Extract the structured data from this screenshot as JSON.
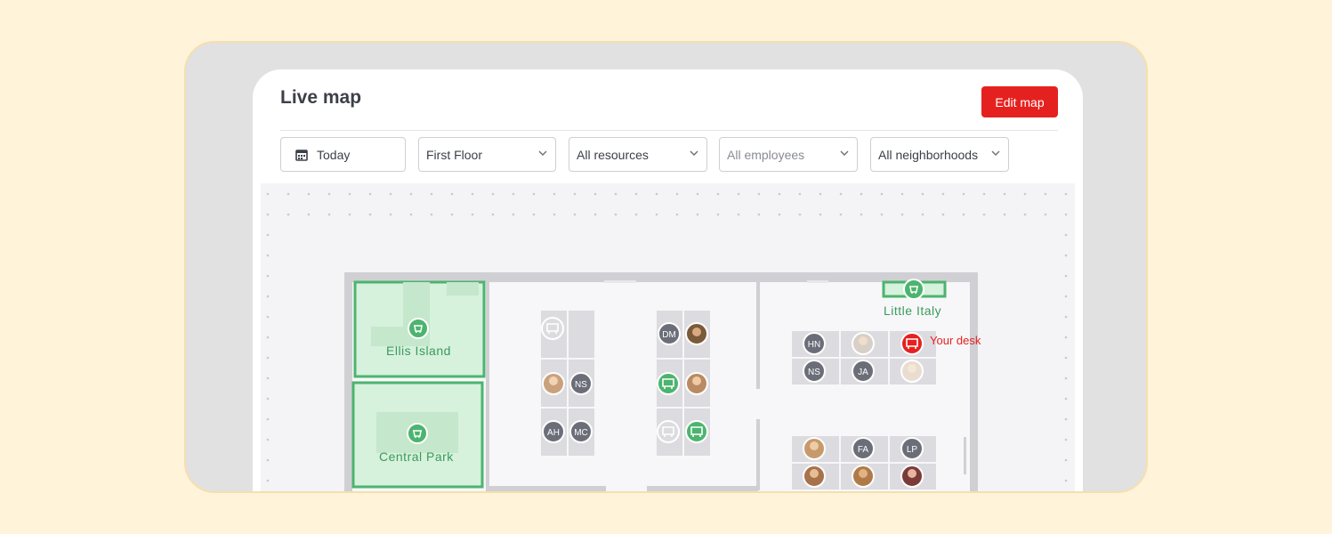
{
  "header": {
    "title": "Live map",
    "edit_label": "Edit map"
  },
  "filters": {
    "date": "Today",
    "floor": "First Floor",
    "resources": "All resources",
    "employees_placeholder": "All employees",
    "neighborhoods": "All neighborhoods"
  },
  "rooms": {
    "ellis": "Ellis Island",
    "central": "Central Park",
    "italy": "Little Italy"
  },
  "your_desk": "Your desk",
  "desks": {
    "dm": "DM",
    "ns1": "NS",
    "ah": "AH",
    "mc": "MC",
    "hn": "HN",
    "ns2": "NS",
    "ja": "JA",
    "fa": "FA",
    "lp": "LP"
  },
  "colors": {
    "accent": "#e5211f",
    "room_green": "#3aa866",
    "avatar_gray": "#6b6e78"
  }
}
